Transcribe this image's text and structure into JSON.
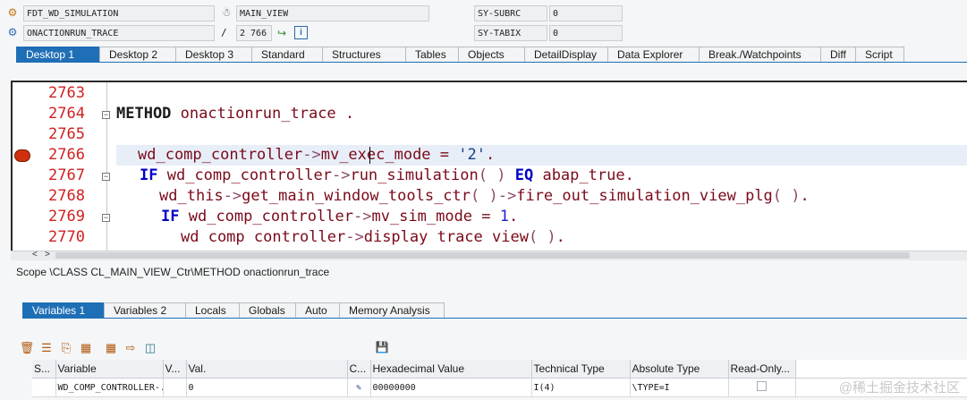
{
  "header": {
    "program": "FDT_WD_SIMULATION",
    "view": "MAIN_VIEW",
    "event": "ONACTIONRUN_TRACE",
    "line_sep": "/",
    "line_no": "2 766",
    "sy_subrc_label": "SY-SUBRC",
    "sy_subrc_value": "0",
    "sy_tabix_label": "SY-TABIX",
    "sy_tabix_value": "0"
  },
  "tabs": [
    "Desktop 1",
    "Desktop 2",
    "Desktop 3",
    "Standard",
    "Structures",
    "Tables",
    "Objects",
    "DetailDisplay",
    "Data Explorer",
    "Break./Watchpoints",
    "Diff",
    "Script"
  ],
  "active_tab": "Desktop 1",
  "editor": {
    "lines": [
      {
        "no": "2763"
      },
      {
        "no": "2764"
      },
      {
        "no": "2765"
      },
      {
        "no": "2766"
      },
      {
        "no": "2767"
      },
      {
        "no": "2768"
      },
      {
        "no": "2769"
      },
      {
        "no": "2770"
      }
    ],
    "code": {
      "l2764_kw": "METHOD",
      "l2764_name": "onactionrun_trace",
      "l2764_dot": ".",
      "l2766_a": "wd_comp_controller",
      "l2766_arrow": "->",
      "l2766_b": "mv_exec_mode",
      "l2766_eq": "=",
      "l2766_str": "'2'",
      "l2766_dot": ".",
      "l2767_if": "IF",
      "l2767_a": "wd_comp_controller",
      "l2767_arrow": "->",
      "l2767_b": "run_simulation",
      "l2767_p": "( )",
      "l2767_eq": "EQ",
      "l2767_c": "abap_true",
      "l2767_dot": ".",
      "l2768_a": "wd_this",
      "l2768_arrow": "->",
      "l2768_b": "get_main_window_tools_ctr",
      "l2768_p": "( )",
      "l2768_arrow2": "->",
      "l2768_c": "fire_out_simulation_view_plg",
      "l2768_p2": "( )",
      "l2768_dot": ".",
      "l2769_if": "IF",
      "l2769_a": "wd_comp_controller",
      "l2769_arrow": "->",
      "l2769_b": "mv_sim_mode",
      "l2769_eq": "=",
      "l2769_num": "1",
      "l2769_dot": ".",
      "l2770_a": "wd comp controller",
      "l2770_arrow": "->",
      "l2770_b": "display trace view",
      "l2770_p": "( )",
      "l2770_dot": "."
    }
  },
  "scope": "Scope \\CLASS CL_MAIN_VIEW_Ctr\\METHOD onactionrun_trace",
  "var_tabs": [
    "Variables 1",
    "Variables 2",
    "Locals",
    "Globals",
    "Auto",
    "Memory Analysis"
  ],
  "active_var_tab": "Variables 1",
  "grid": {
    "columns": [
      "S...",
      "Variable",
      "V...",
      "Val.",
      "C...",
      "Hexadecimal Value",
      "Technical Type",
      "Absolute Type",
      "Read-Only..."
    ],
    "rows": [
      {
        "variable": "WD_COMP_CONTROLLER-...",
        "value": "0",
        "hex": "00000000",
        "tech_type": "I(4)",
        "abs_type": "\\TYPE=I"
      }
    ]
  },
  "watermark": "@稀土掘金技术社区",
  "colors": {
    "accent": "#1f6fb6",
    "line_number": "#d02020",
    "keyword": "#0000c8"
  }
}
